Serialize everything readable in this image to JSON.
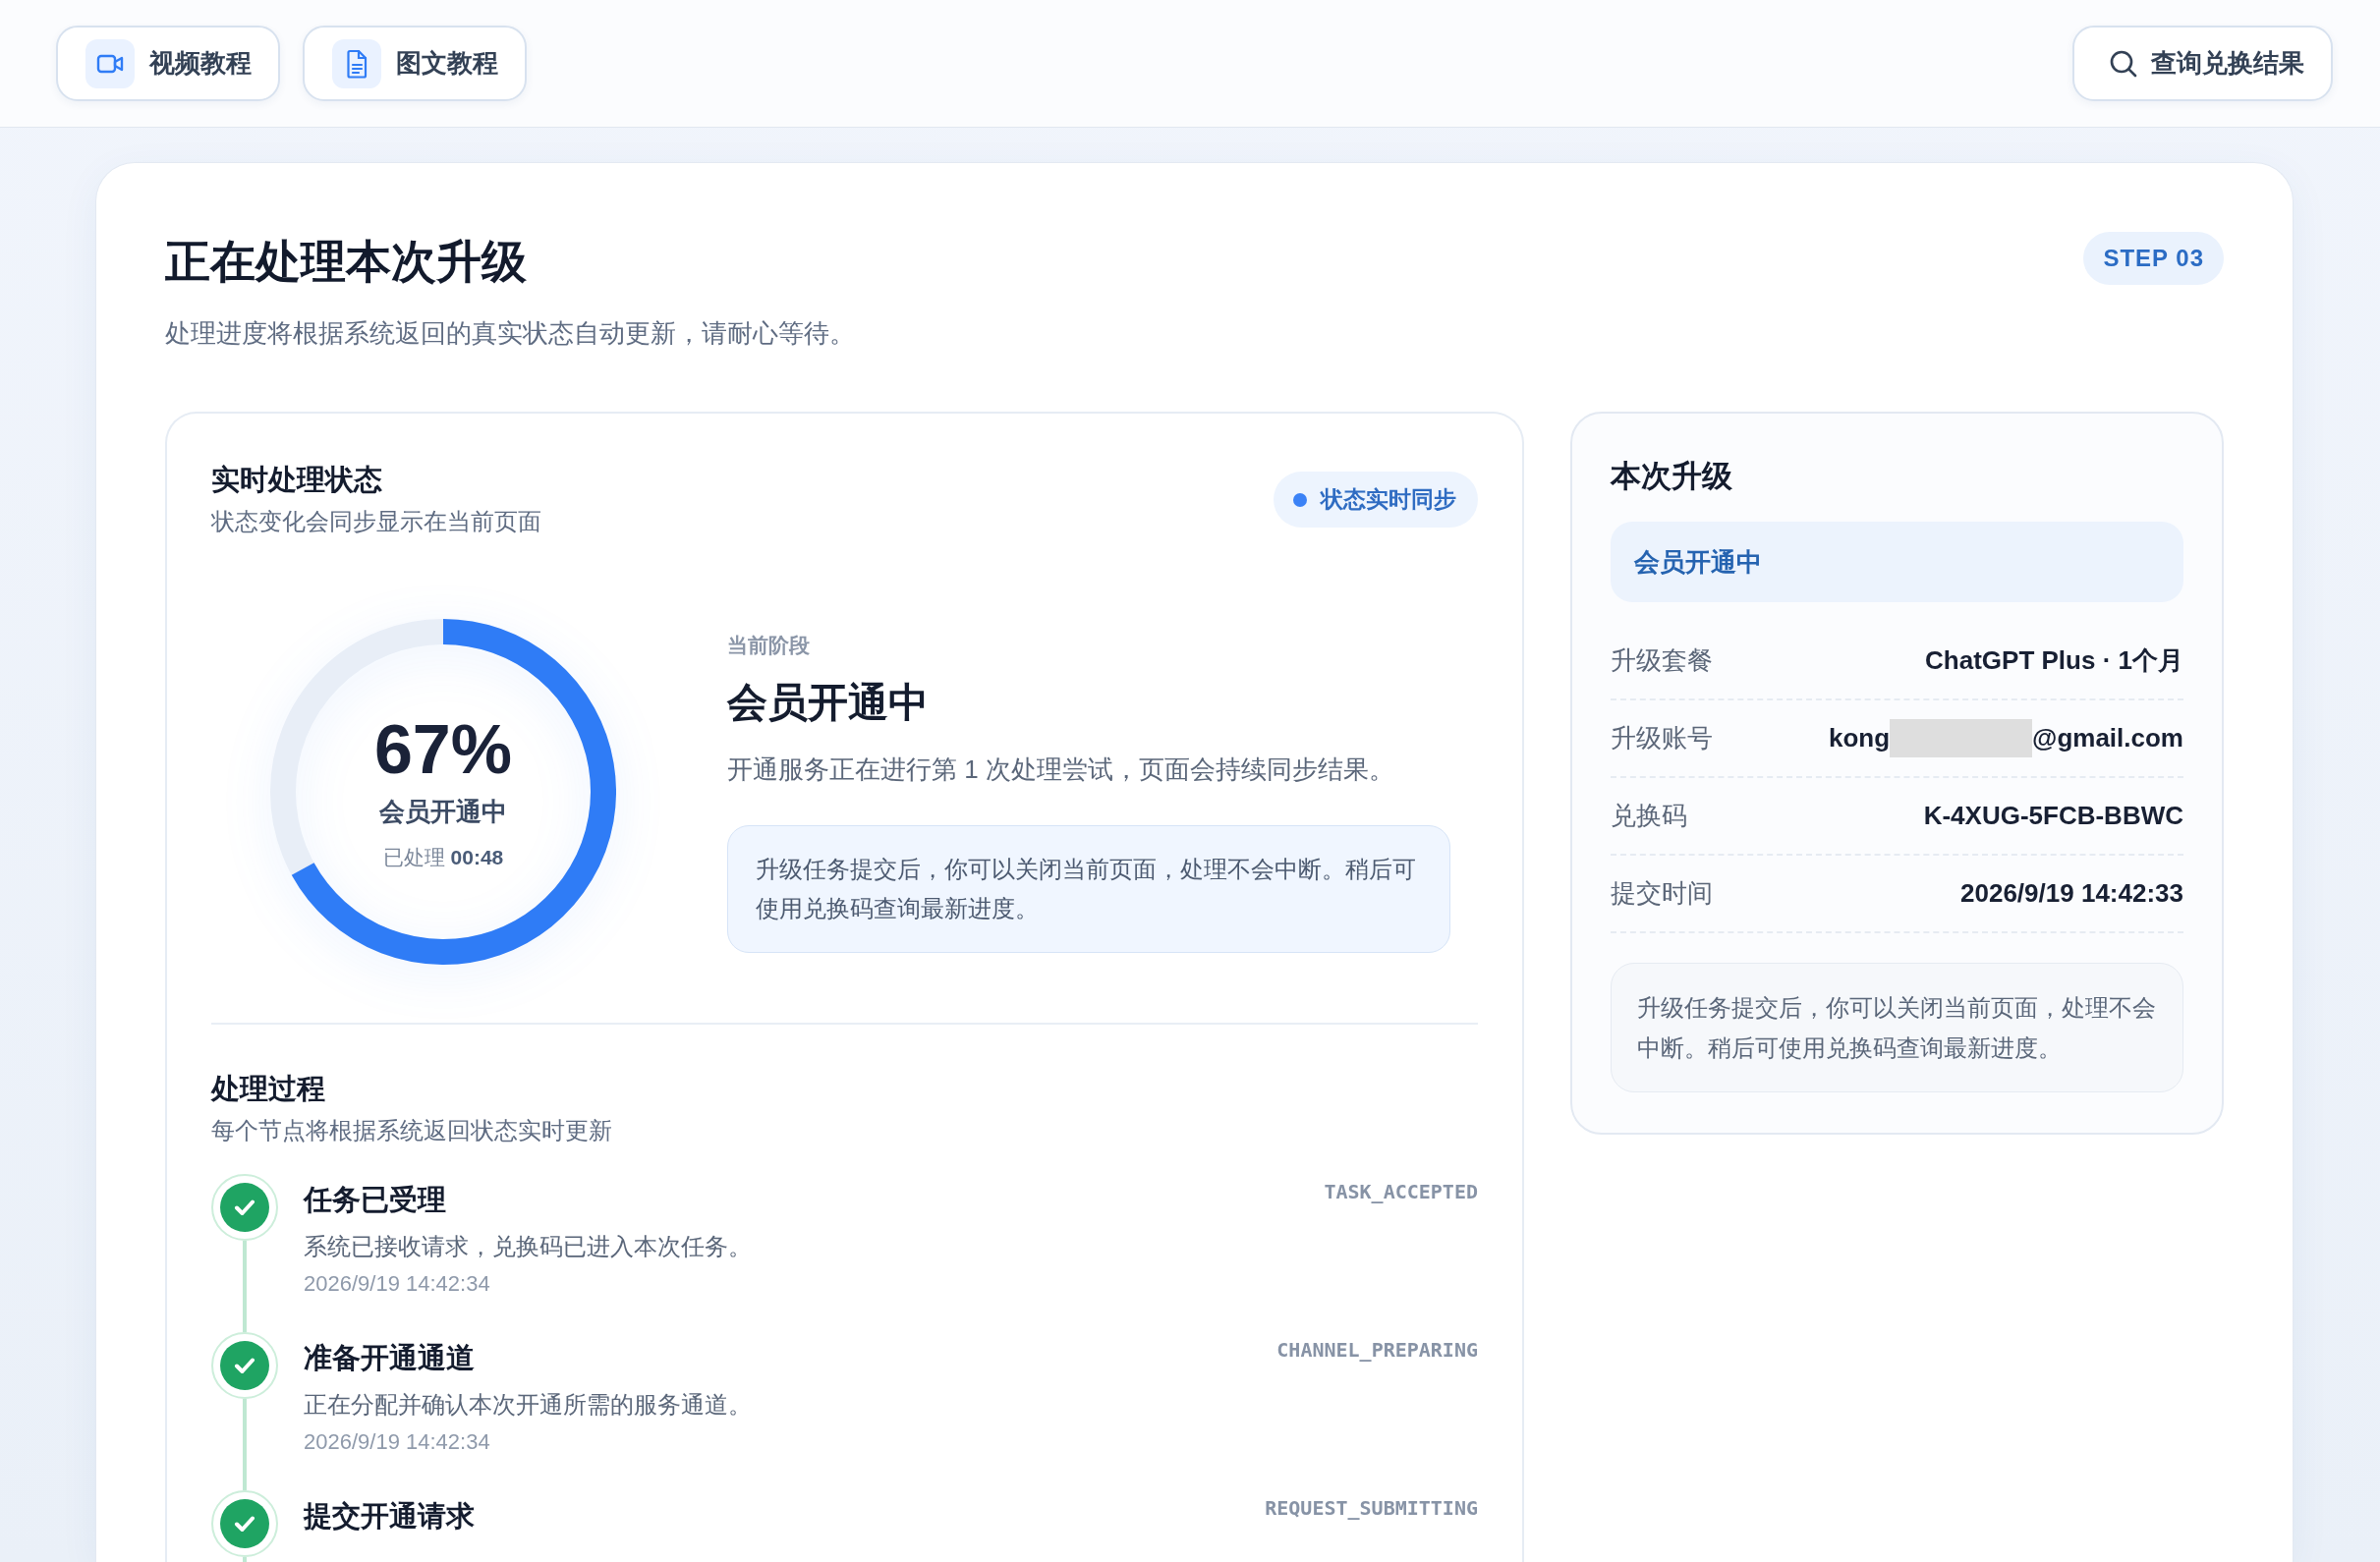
{
  "top_bar": {
    "buttons": [
      {
        "kind": "video",
        "label": "视频教程"
      },
      {
        "kind": "document",
        "label": "图文教程"
      }
    ],
    "search_button": {
      "label": "查询兑换结果"
    }
  },
  "header": {
    "title": "正在处理本次升级",
    "subtitle": "处理进度将根据系统返回的真实状态自动更新，请耐心等待。",
    "step_badge": "STEP 03"
  },
  "status_panel": {
    "title": "实时处理状态",
    "subtitle": "状态变化会同步显示在当前页面",
    "sync_badge": "状态实时同步",
    "progress": {
      "percent": "67%",
      "label": "会员开通中",
      "elapsed": "已处理 **00:48**"
    },
    "stage": {
      "caption": "当前阶段",
      "title": "会员开通中",
      "description": "开通服务正在进行第 1 次处理尝试，页面会持续同步结果。",
      "notice": "升级任务提交后，你可以关闭当前页面，处理不会中断。稍后可使用兑换码查询最新进度。"
    }
  },
  "process": {
    "title": "处理过程",
    "subtitle": "每个节点将根据系统返回状态实时更新",
    "steps": [
      {
        "title": "任务已受理",
        "description": "系统已接收请求，兑换码已进入本次任务。",
        "time": "2026/9/19 14:42:34",
        "code": "TASK_ACCEPTED",
        "done": true
      },
      {
        "title": "准备开通通道",
        "description": "正在分配并确认本次开通所需的服务通道。",
        "time": "2026/9/19 14:42:34",
        "code": "CHANNEL_PREPARING",
        "done": true
      },
      {
        "title": "提交开通请求",
        "code": "REQUEST_SUBMITTING",
        "done": true
      }
    ]
  },
  "summary_panel": {
    "title": "本次升级",
    "status": "会员开通中",
    "rows": [
      {
        "kind": "text",
        "label": "升级套餐",
        "value": "ChatGPT Plus · 1个月"
      },
      {
        "kind": "redacted",
        "label": "升级账号",
        "value_start": "kong",
        "value_end": "@gmail.com"
      },
      {
        "kind": "text",
        "label": "兑换码",
        "value": "K-4XUG-5FCB-BBWC"
      },
      {
        "kind": "text",
        "label": "提交时间",
        "value": "2026/9/19 14:42:33"
      }
    ],
    "notice": "升级任务提交后，你可以关闭当前页面，处理不会中断。稍后可使用兑换码查询最新进度。"
  }
}
